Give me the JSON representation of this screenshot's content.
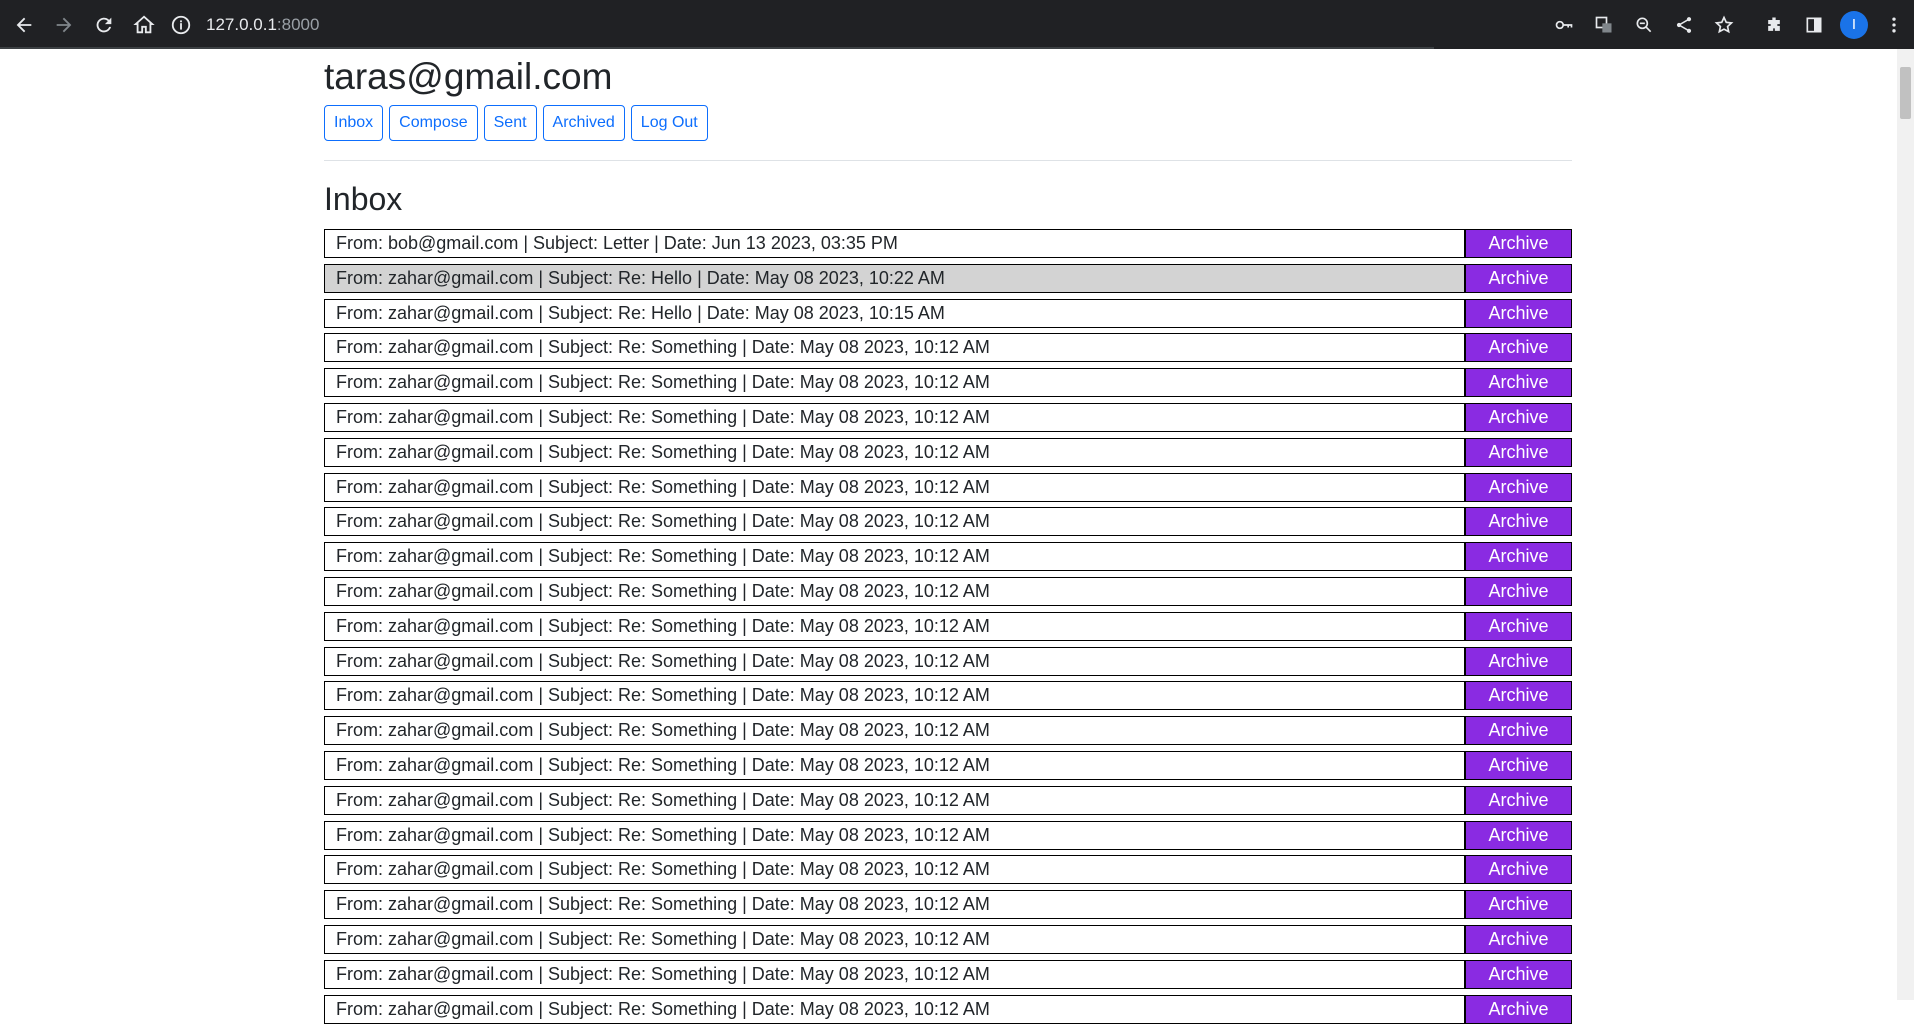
{
  "browser": {
    "url_host": "127.0.0.1",
    "url_port": ":8000",
    "profile_initial": "I"
  },
  "page": {
    "user_email": "taras@gmail.com",
    "nav": [
      "Inbox",
      "Compose",
      "Sent",
      "Archived",
      "Log Out"
    ],
    "section_title": "Inbox",
    "archive_label": "Archive",
    "emails": [
      {
        "summary": "From: bob@gmail.com | Subject: Letter | Date: Jun 13 2023, 03:35 PM",
        "read": false
      },
      {
        "summary": "From: zahar@gmail.com | Subject: Re: Hello | Date: May 08 2023, 10:22 AM",
        "read": true
      },
      {
        "summary": "From: zahar@gmail.com | Subject: Re: Hello | Date: May 08 2023, 10:15 AM",
        "read": false
      },
      {
        "summary": "From: zahar@gmail.com | Subject: Re: Something | Date: May 08 2023, 10:12 AM",
        "read": false
      },
      {
        "summary": "From: zahar@gmail.com | Subject: Re: Something | Date: May 08 2023, 10:12 AM",
        "read": false
      },
      {
        "summary": "From: zahar@gmail.com | Subject: Re: Something | Date: May 08 2023, 10:12 AM",
        "read": false
      },
      {
        "summary": "From: zahar@gmail.com | Subject: Re: Something | Date: May 08 2023, 10:12 AM",
        "read": false
      },
      {
        "summary": "From: zahar@gmail.com | Subject: Re: Something | Date: May 08 2023, 10:12 AM",
        "read": false
      },
      {
        "summary": "From: zahar@gmail.com | Subject: Re: Something | Date: May 08 2023, 10:12 AM",
        "read": false
      },
      {
        "summary": "From: zahar@gmail.com | Subject: Re: Something | Date: May 08 2023, 10:12 AM",
        "read": false
      },
      {
        "summary": "From: zahar@gmail.com | Subject: Re: Something | Date: May 08 2023, 10:12 AM",
        "read": false
      },
      {
        "summary": "From: zahar@gmail.com | Subject: Re: Something | Date: May 08 2023, 10:12 AM",
        "read": false
      },
      {
        "summary": "From: zahar@gmail.com | Subject: Re: Something | Date: May 08 2023, 10:12 AM",
        "read": false
      },
      {
        "summary": "From: zahar@gmail.com | Subject: Re: Something | Date: May 08 2023, 10:12 AM",
        "read": false
      },
      {
        "summary": "From: zahar@gmail.com | Subject: Re: Something | Date: May 08 2023, 10:12 AM",
        "read": false
      },
      {
        "summary": "From: zahar@gmail.com | Subject: Re: Something | Date: May 08 2023, 10:12 AM",
        "read": false
      },
      {
        "summary": "From: zahar@gmail.com | Subject: Re: Something | Date: May 08 2023, 10:12 AM",
        "read": false
      },
      {
        "summary": "From: zahar@gmail.com | Subject: Re: Something | Date: May 08 2023, 10:12 AM",
        "read": false
      },
      {
        "summary": "From: zahar@gmail.com | Subject: Re: Something | Date: May 08 2023, 10:12 AM",
        "read": false
      },
      {
        "summary": "From: zahar@gmail.com | Subject: Re: Something | Date: May 08 2023, 10:12 AM",
        "read": false
      },
      {
        "summary": "From: zahar@gmail.com | Subject: Re: Something | Date: May 08 2023, 10:12 AM",
        "read": false
      },
      {
        "summary": "From: zahar@gmail.com | Subject: Re: Something | Date: May 08 2023, 10:12 AM",
        "read": false
      },
      {
        "summary": "From: zahar@gmail.com | Subject: Re: Something | Date: May 08 2023, 10:12 AM",
        "read": false
      }
    ]
  }
}
